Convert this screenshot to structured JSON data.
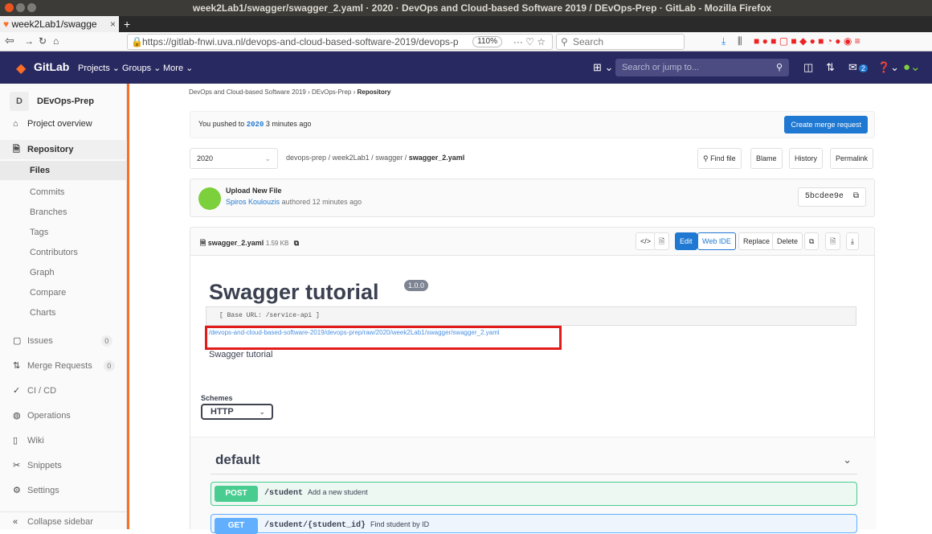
{
  "window": {
    "title": "week2Lab1/swagger/swagger_2.yaml · 2020 · DevOps and Cloud-based Software 2019 / DEvOps-Prep · GitLab - Mozilla Firefox"
  },
  "browser": {
    "tab_title": "week2Lab1/swagge",
    "tab_close": "×",
    "new_tab": "+",
    "url": "https://gitlab-fnwi.uva.nl/devops-and-cloud-based-software-2019/devops-p",
    "zoom": "110%",
    "search_placeholder": "Search"
  },
  "gitlab_nav": {
    "brand": "GitLab",
    "projects": "Projects ⌄",
    "groups": "Groups ⌄",
    "more": "More ⌄",
    "search_placeholder": "Search or jump to...",
    "todo_count": "2"
  },
  "sidebar": {
    "project_initial": "D",
    "project_name": "DEvOps-Prep",
    "items": [
      {
        "label": "Project overview",
        "icon": "⌂"
      },
      {
        "label": "Repository",
        "icon": "🗎"
      },
      {
        "label": "Files"
      },
      {
        "label": "Commits"
      },
      {
        "label": "Branches"
      },
      {
        "label": "Tags"
      },
      {
        "label": "Contributors"
      },
      {
        "label": "Graph"
      },
      {
        "label": "Compare"
      },
      {
        "label": "Charts"
      },
      {
        "label": "Issues",
        "icon": "▢",
        "badge": "0"
      },
      {
        "label": "Merge Requests",
        "icon": "⇅",
        "badge": "0"
      },
      {
        "label": "CI / CD",
        "icon": "✓"
      },
      {
        "label": "Operations",
        "icon": "◍"
      },
      {
        "label": "Wiki",
        "icon": "▯"
      },
      {
        "label": "Snippets",
        "icon": "✂"
      },
      {
        "label": "Settings",
        "icon": "⚙"
      },
      {
        "label": "Collapse sidebar",
        "icon": "«"
      }
    ]
  },
  "breadcrumb": {
    "group": "DevOps and Cloud-based Software 2019",
    "sep": "›",
    "project": "DEvOps-Prep",
    "current": "Repository"
  },
  "push_banner": {
    "prefix": "You pushed to",
    "branch": "2020",
    "suffix": "3 minutes ago",
    "button": "Create merge request"
  },
  "path": {
    "branch": "2020",
    "segments": [
      "devops-prep",
      "week2Lab1",
      "swagger"
    ],
    "file": "swagger_2.yaml",
    "sep": "/",
    "buttons": {
      "find": "Find file",
      "blame": "Blame",
      "history": "History",
      "permalink": "Permalink"
    }
  },
  "commit": {
    "title": "Upload New File",
    "author": "Spiros Koulouzis",
    "text": "authored 12 minutes ago",
    "sha": "5bcdee9e"
  },
  "file": {
    "name": "swagger_2.yaml",
    "size": "1.59 KB",
    "edit": "Edit",
    "webide": "Web IDE",
    "replace": "Replace",
    "delete": "Delete"
  },
  "swagger": {
    "title": "Swagger tutorial",
    "version": "1.0.0",
    "base_url": "[ Base URL: /service-api ]",
    "raw_link": "/devops-and-cloud-based-software-2019/devops-prep/raw/2020/week2Lab1/swagger/swagger_2.yaml",
    "description": "Swagger tutorial",
    "schemes_label": "Schemes",
    "scheme": "HTTP",
    "section": "default",
    "operations": [
      {
        "method": "POST",
        "path": "/student",
        "summary": "Add a new student",
        "color": "#49cc90",
        "bg": "#edf8f3"
      },
      {
        "method": "GET",
        "path": "/student/{student_id}",
        "summary": "Find student by ID",
        "color": "#61affe",
        "bg": "#eef5fd"
      }
    ]
  }
}
